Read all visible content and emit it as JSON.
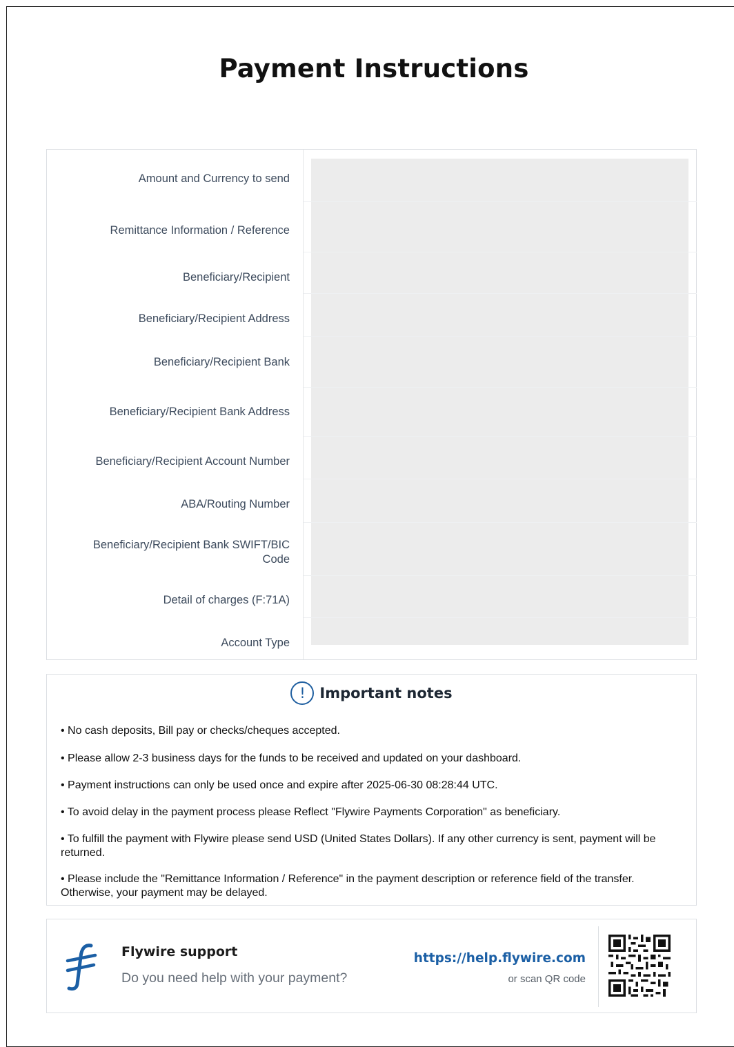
{
  "title": "Payment Instructions",
  "details": {
    "rows": [
      {
        "label": "Amount and Currency to send"
      },
      {
        "label": "Remittance Information / Reference"
      },
      {
        "label": "Beneficiary/Recipient"
      },
      {
        "label": "Beneficiary/Recipient Address"
      },
      {
        "label": "Beneficiary/Recipient Bank"
      },
      {
        "label": "Beneficiary/Recipient Bank Address"
      },
      {
        "label": "Beneficiary/Recipient Account Number"
      },
      {
        "label": "ABA/Routing Number"
      },
      {
        "label": "Beneficiary/Recipient Bank SWIFT/BIC Code"
      },
      {
        "label": "Detail of charges (F:71A)"
      },
      {
        "label": "Account Type"
      }
    ]
  },
  "notes": {
    "icon": "alert-circle-icon",
    "title": "Important notes",
    "items": [
      "• No cash deposits, Bill pay or checks/cheques accepted.",
      "• Please allow 2-3 business days for the funds to be received and updated on your dashboard.",
      "• Payment instructions can only be used once and expire after 2025-06-30 08:28:44 UTC.",
      "• To avoid delay in the payment process please Reflect \"Flywire Payments Corporation\" as beneficiary.",
      "• To fulfill the payment with Flywire please send USD (United States Dollars). If any other currency is sent, payment will be returned.",
      "• Please include the  \"Remittance Information / Reference\"  in the payment description or reference field of the transfer. Otherwise, your payment may be delayed."
    ]
  },
  "support": {
    "logo_icon": "flywire-logo-icon",
    "title": "Flywire support",
    "subtitle": "Do you need help with your payment?",
    "link": "https://help.flywire.com",
    "scan_text": "or scan QR code",
    "qr_icon": "qr-code-icon"
  },
  "colors": {
    "brand_blue": "#1b5fa5",
    "redacted_gray": "#ececec"
  }
}
